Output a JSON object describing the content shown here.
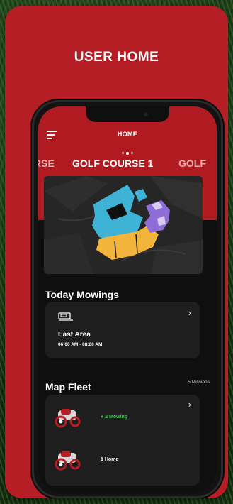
{
  "page_title": "USER HOME",
  "app": {
    "header_title": "HOME",
    "course_tabs": [
      "RSE",
      "GOLF COURSE 1",
      "GOLF"
    ],
    "today_mowings": {
      "title": "Today Mowings",
      "area": "East Area",
      "time": "06:00 AM - 08:00 AM"
    },
    "map_fleet": {
      "title": "Map Fleet",
      "count_label": "5 Missions",
      "statuses": [
        {
          "label": "2 Mowing",
          "color": "#3fbf4f"
        },
        {
          "label": "1 Home",
          "color": "#ffffff"
        }
      ]
    }
  },
  "colors": {
    "brand_red": "#b51e25",
    "map_zone_blue": "#3fb3d6",
    "map_zone_yellow": "#f2b43a",
    "map_zone_purple": "#8f6dd6",
    "mowing_green": "#3fbf4f"
  }
}
